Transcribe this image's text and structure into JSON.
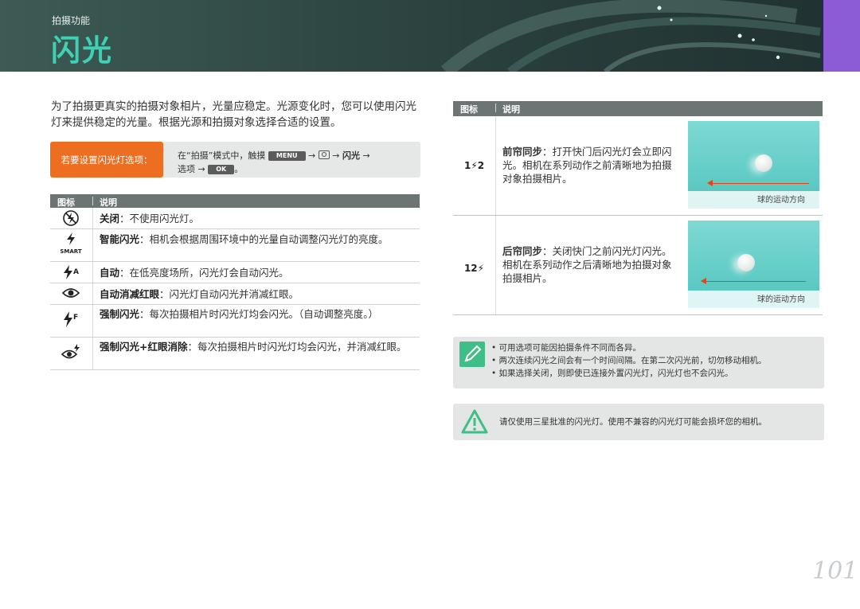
{
  "header": {
    "section": "拍摄功能",
    "title": "闪光"
  },
  "intro": "为了拍摄更真实的拍摄对象相片，光量应稳定。光源变化时，您可以使用闪光灯来提供稳定的光量。根据光源和拍摄对象选择合适的设置。",
  "setting": {
    "tag": "若要设置闪光灯选项：",
    "line1_a": "在“拍摄”模式中，触摸",
    "key_menu": "MENU",
    "arrow": "→",
    "flash": "闪光",
    "line2_a": "选项",
    "key_ok": "OK",
    "period": "。"
  },
  "left_table": {
    "col_icon": "图标",
    "col_desc": "说明",
    "rows": [
      {
        "icon": "flash-off-icon",
        "title": "关闭",
        "text": "：不使用闪光灯。"
      },
      {
        "icon": "smart-flash-icon",
        "smart": "SMART",
        "title": "智能闪光",
        "text": "：相机会根据周围环境中的光量自动调整闪光灯的亮度。"
      },
      {
        "icon": "auto-flash-icon",
        "title": "自动",
        "text": "：在低亮度场所，闪光灯会自动闪光。"
      },
      {
        "icon": "red-eye-icon",
        "title": "自动消减红眼",
        "text": "：闪光灯自动闪光并消减红眼。"
      },
      {
        "icon": "fill-flash-icon",
        "title": "强制闪光",
        "text": "：每次拍摄相片时闪光灯均会闪光。（自动调整亮度。）"
      },
      {
        "icon": "fill-red-eye-icon",
        "title": "强制闪光+红眼消除",
        "text": "：每次拍摄相片时闪光灯均会闪光，并消减红眼。"
      }
    ]
  },
  "right_table": {
    "col_icon": "图标",
    "col_desc": "说明",
    "rows": [
      {
        "icon_text": "1⚡2",
        "title": "前帘同步",
        "text": "：打开快门后闪光灯会立即闪光。相机在系列动作之前清晰地为拍摄对象拍摄相片。",
        "caption": "球的运动方向"
      },
      {
        "icon_text": "12⚡",
        "title": "后帘同步",
        "text": "：关闭快门之前闪光灯闪光。相机在系列动作之后清晰地为拍摄对象拍摄相片。",
        "caption": "球的运动方向"
      }
    ]
  },
  "note": {
    "items": [
      "可用选项可能因拍摄条件不同而各异。",
      "两次连续闪光之间会有一个时间间隔。在第二次闪光前，切勿移动相机。",
      "如果选择关闭，则即使已连接外置闪光灯，闪光灯也不会闪光。"
    ]
  },
  "warning": "请仅使用三星批准的闪光灯。使用不兼容的闪光灯可能会损坏您的相机。",
  "page_number": "101",
  "colors": {
    "title": "#3fd1b4",
    "orange": "#ee6e21",
    "purple_tab": "#8c5bd6",
    "note_green": "#3dbf87"
  }
}
